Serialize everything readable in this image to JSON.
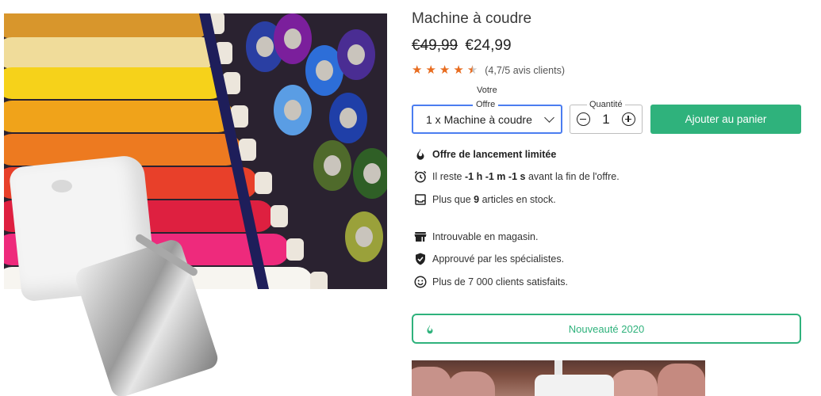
{
  "product": {
    "title": "Machine à coudre",
    "price_old": "€49,99",
    "price_new": "€24,99",
    "rating_value": 4.7,
    "rating_max": 5,
    "rating_text": "(4,7/5 avis clients)"
  },
  "offer": {
    "label_top": "Votre",
    "label": "Offre",
    "selected": "1 x Machine à coudre"
  },
  "quantity": {
    "label": "Quantité",
    "value": "1"
  },
  "cart": {
    "add_label": "Ajouter au panier"
  },
  "features": {
    "launch": "Offre de lancement limitée",
    "countdown": {
      "prefix": "Il reste",
      "hours": "-1 h",
      "minutes": "-1 m",
      "seconds": "-1 s",
      "suffix": "avant la fin de l'offre."
    },
    "stock": {
      "prefix": "Plus que",
      "count": "9",
      "suffix": "articles en stock."
    },
    "store": "Introuvable en magasin.",
    "approved": "Approuvé par les spécialistes.",
    "clients": "Plus de 7 000 clients satisfaits."
  },
  "badge": {
    "label": "Nouveauté 2020"
  },
  "colors": {
    "accent_green": "#2fb27c",
    "select_border": "#4b7df0",
    "star": "#e86c1f"
  },
  "icons": {
    "launch": "fire-icon",
    "countdown": "alarm-clock-icon",
    "stock": "inbox-icon",
    "store": "store-icon",
    "approved": "verified-shield-icon",
    "clients": "smiley-icon",
    "badge": "fire-icon"
  }
}
